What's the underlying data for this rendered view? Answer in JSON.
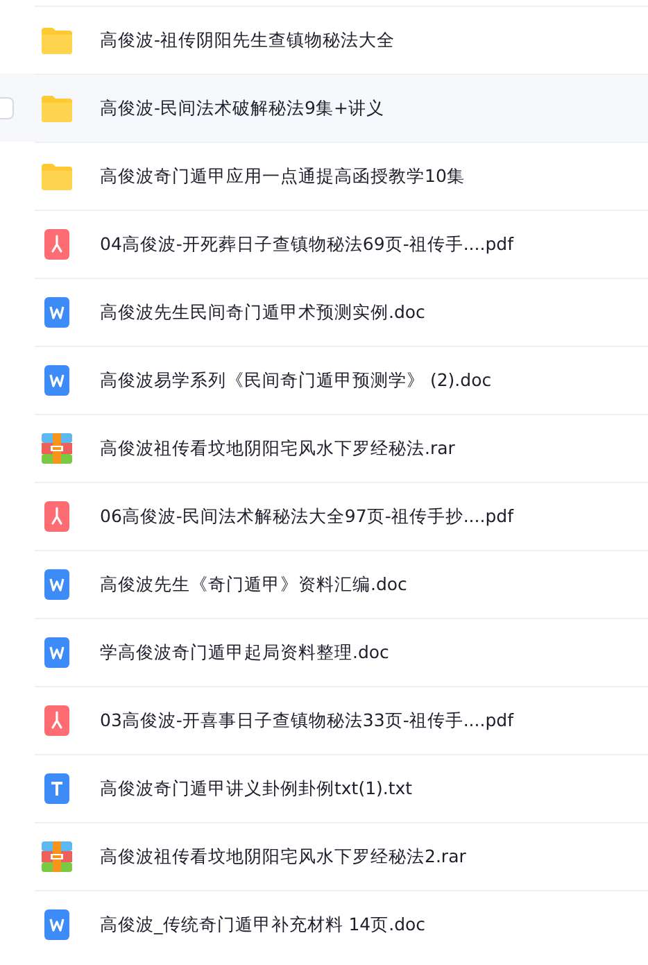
{
  "files": [
    {
      "kind": "folder",
      "name": "高俊波-祖传阴阳先生查镇物秘法大全",
      "hovered": false
    },
    {
      "kind": "folder",
      "name": "高俊波-民间法术破解秘法9集+讲义",
      "hovered": true
    },
    {
      "kind": "folder",
      "name": "高俊波奇门遁甲应用一点通提高函授教学10集",
      "hovered": false
    },
    {
      "kind": "pdf",
      "name": "04高俊波-开死葬日子查镇物秘法69页-祖传手....pdf",
      "hovered": false
    },
    {
      "kind": "doc",
      "name": "高俊波先生民间奇门遁甲术预测实例.doc",
      "hovered": false
    },
    {
      "kind": "doc",
      "name": "高俊波易学系列《民间奇门遁甲预测学》 (2).doc",
      "hovered": false
    },
    {
      "kind": "rar",
      "name": "高俊波祖传看坟地阴阳宅风水下罗经秘法.rar",
      "hovered": false
    },
    {
      "kind": "pdf",
      "name": "06高俊波-民间法术解秘法大全97页-祖传手抄....pdf",
      "hovered": false
    },
    {
      "kind": "doc",
      "name": "高俊波先生《奇门遁甲》资料汇编.doc",
      "hovered": false
    },
    {
      "kind": "doc",
      "name": "学高俊波奇门遁甲起局资料整理.doc",
      "hovered": false
    },
    {
      "kind": "pdf",
      "name": "03高俊波-开喜事日子查镇物秘法33页-祖传手....pdf",
      "hovered": false
    },
    {
      "kind": "txt",
      "name": "高俊波奇门遁甲讲义卦例卦例txt(1).txt",
      "hovered": false
    },
    {
      "kind": "rar",
      "name": "高俊波祖传看坟地阴阳宅风水下罗经秘法2.rar",
      "hovered": false
    },
    {
      "kind": "doc",
      "name": "高俊波_传统奇门遁甲补充材料 14页.doc",
      "hovered": false
    }
  ]
}
